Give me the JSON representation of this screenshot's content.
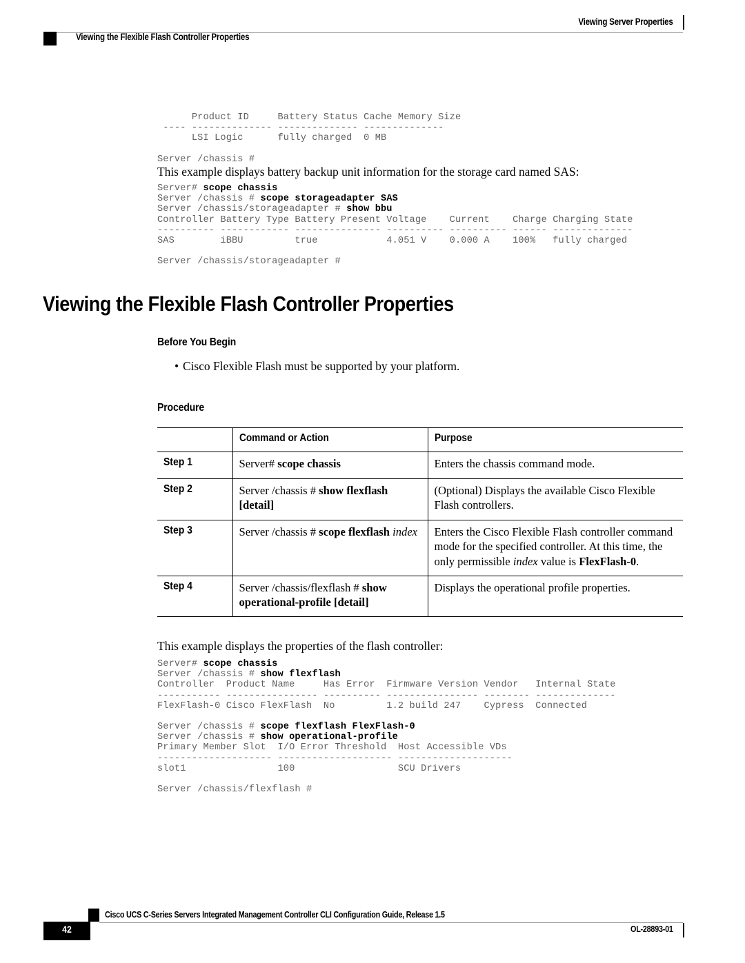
{
  "header": {
    "running_head": "Viewing Server Properties",
    "section_label": "Viewing the Flexible Flash Controller Properties"
  },
  "code_block_1": "      Product ID     Battery Status Cache Memory Size\n ---- -------------- -------------- --------------\n      LSI Logic      fully charged  0 MB\n\nServer /chassis #",
  "paragraph_1": "This example displays battery backup unit information for the storage card named SAS:",
  "code_block_2": {
    "lines": [
      {
        "prompt": "Server# ",
        "cmd": "scope chassis"
      },
      {
        "prompt": "Server /chassis # ",
        "cmd": "scope storageadapter SAS"
      },
      {
        "prompt": "Server /chassis/storageadapter # ",
        "cmd": "show bbu"
      }
    ],
    "output": "Controller Battery Type Battery Present Voltage    Current    Charge Charging State\n---------- ------------ --------------- ---------- ---------- ------ --------------\nSAS        iBBU         true            4.051 V    0.000 A    100%   fully charged\n\nServer /chassis/storageadapter #"
  },
  "title": "Viewing the Flexible Flash Controller Properties",
  "before_you_begin": {
    "heading": "Before You Begin",
    "bullets": [
      "Cisco Flexible Flash must be supported by your platform."
    ]
  },
  "procedure": {
    "heading": "Procedure",
    "columns": [
      "",
      "Command or Action",
      "Purpose"
    ],
    "rows": [
      {
        "step": "Step 1",
        "command_plain": "Server# ",
        "command_bold": "scope chassis",
        "command_italic": "",
        "command_tail": "",
        "purpose": "Enters the chassis command mode."
      },
      {
        "step": "Step 2",
        "command_plain": "Server /chassis # ",
        "command_bold": "show flexflash [detail]",
        "command_italic": "",
        "command_tail": "",
        "purpose": "(Optional) Displays the available Cisco Flexible Flash controllers."
      },
      {
        "step": "Step 3",
        "command_plain": "Server /chassis # ",
        "command_bold": "scope flexflash ",
        "command_italic": "index",
        "command_tail": "",
        "purpose_pre": "Enters the Cisco Flexible Flash controller command mode for the specified controller. At this time, the only permissible ",
        "purpose_italic": "index",
        "purpose_mid": " value is ",
        "purpose_bold": "FlexFlash-0",
        "purpose_post": "."
      },
      {
        "step": "Step 4",
        "command_plain": "Server /chassis/flexflash # ",
        "command_bold": "show operational-profile [detail]",
        "command_italic": "",
        "command_tail": "",
        "purpose": "Displays the operational profile properties."
      }
    ]
  },
  "paragraph_2": "This example displays the properties of the flash controller:",
  "code_block_3": {
    "lines": [
      {
        "prompt": "Server# ",
        "cmd": "scope chassis"
      },
      {
        "prompt": "Server /chassis # ",
        "cmd": "show flexflash"
      }
    ],
    "output": "Controller  Product Name     Has Error  Firmware Version Vendor   Internal State\n----------- ---------------- ---------- ---------------- -------- --------------\nFlexFlash-0 Cisco FlexFlash  No         1.2 build 247    Cypress  Connected"
  },
  "code_block_4": {
    "lines": [
      {
        "prompt": "Server /chassis # ",
        "cmd": "scope flexflash FlexFlash-0"
      },
      {
        "prompt": "Server /chassis # ",
        "cmd": "show operational-profile"
      }
    ],
    "output": "Primary Member Slot  I/O Error Threshold  Host Accessible VDs\n-------------------- -------------------- --------------------\nslot1                100                  SCU Drivers\n\nServer /chassis/flexflash #"
  },
  "footer": {
    "guide_title": "Cisco UCS C-Series Servers Integrated Management Controller CLI Configuration Guide, Release 1.5",
    "page_number": "42",
    "doc_id": "OL-28893-01"
  }
}
